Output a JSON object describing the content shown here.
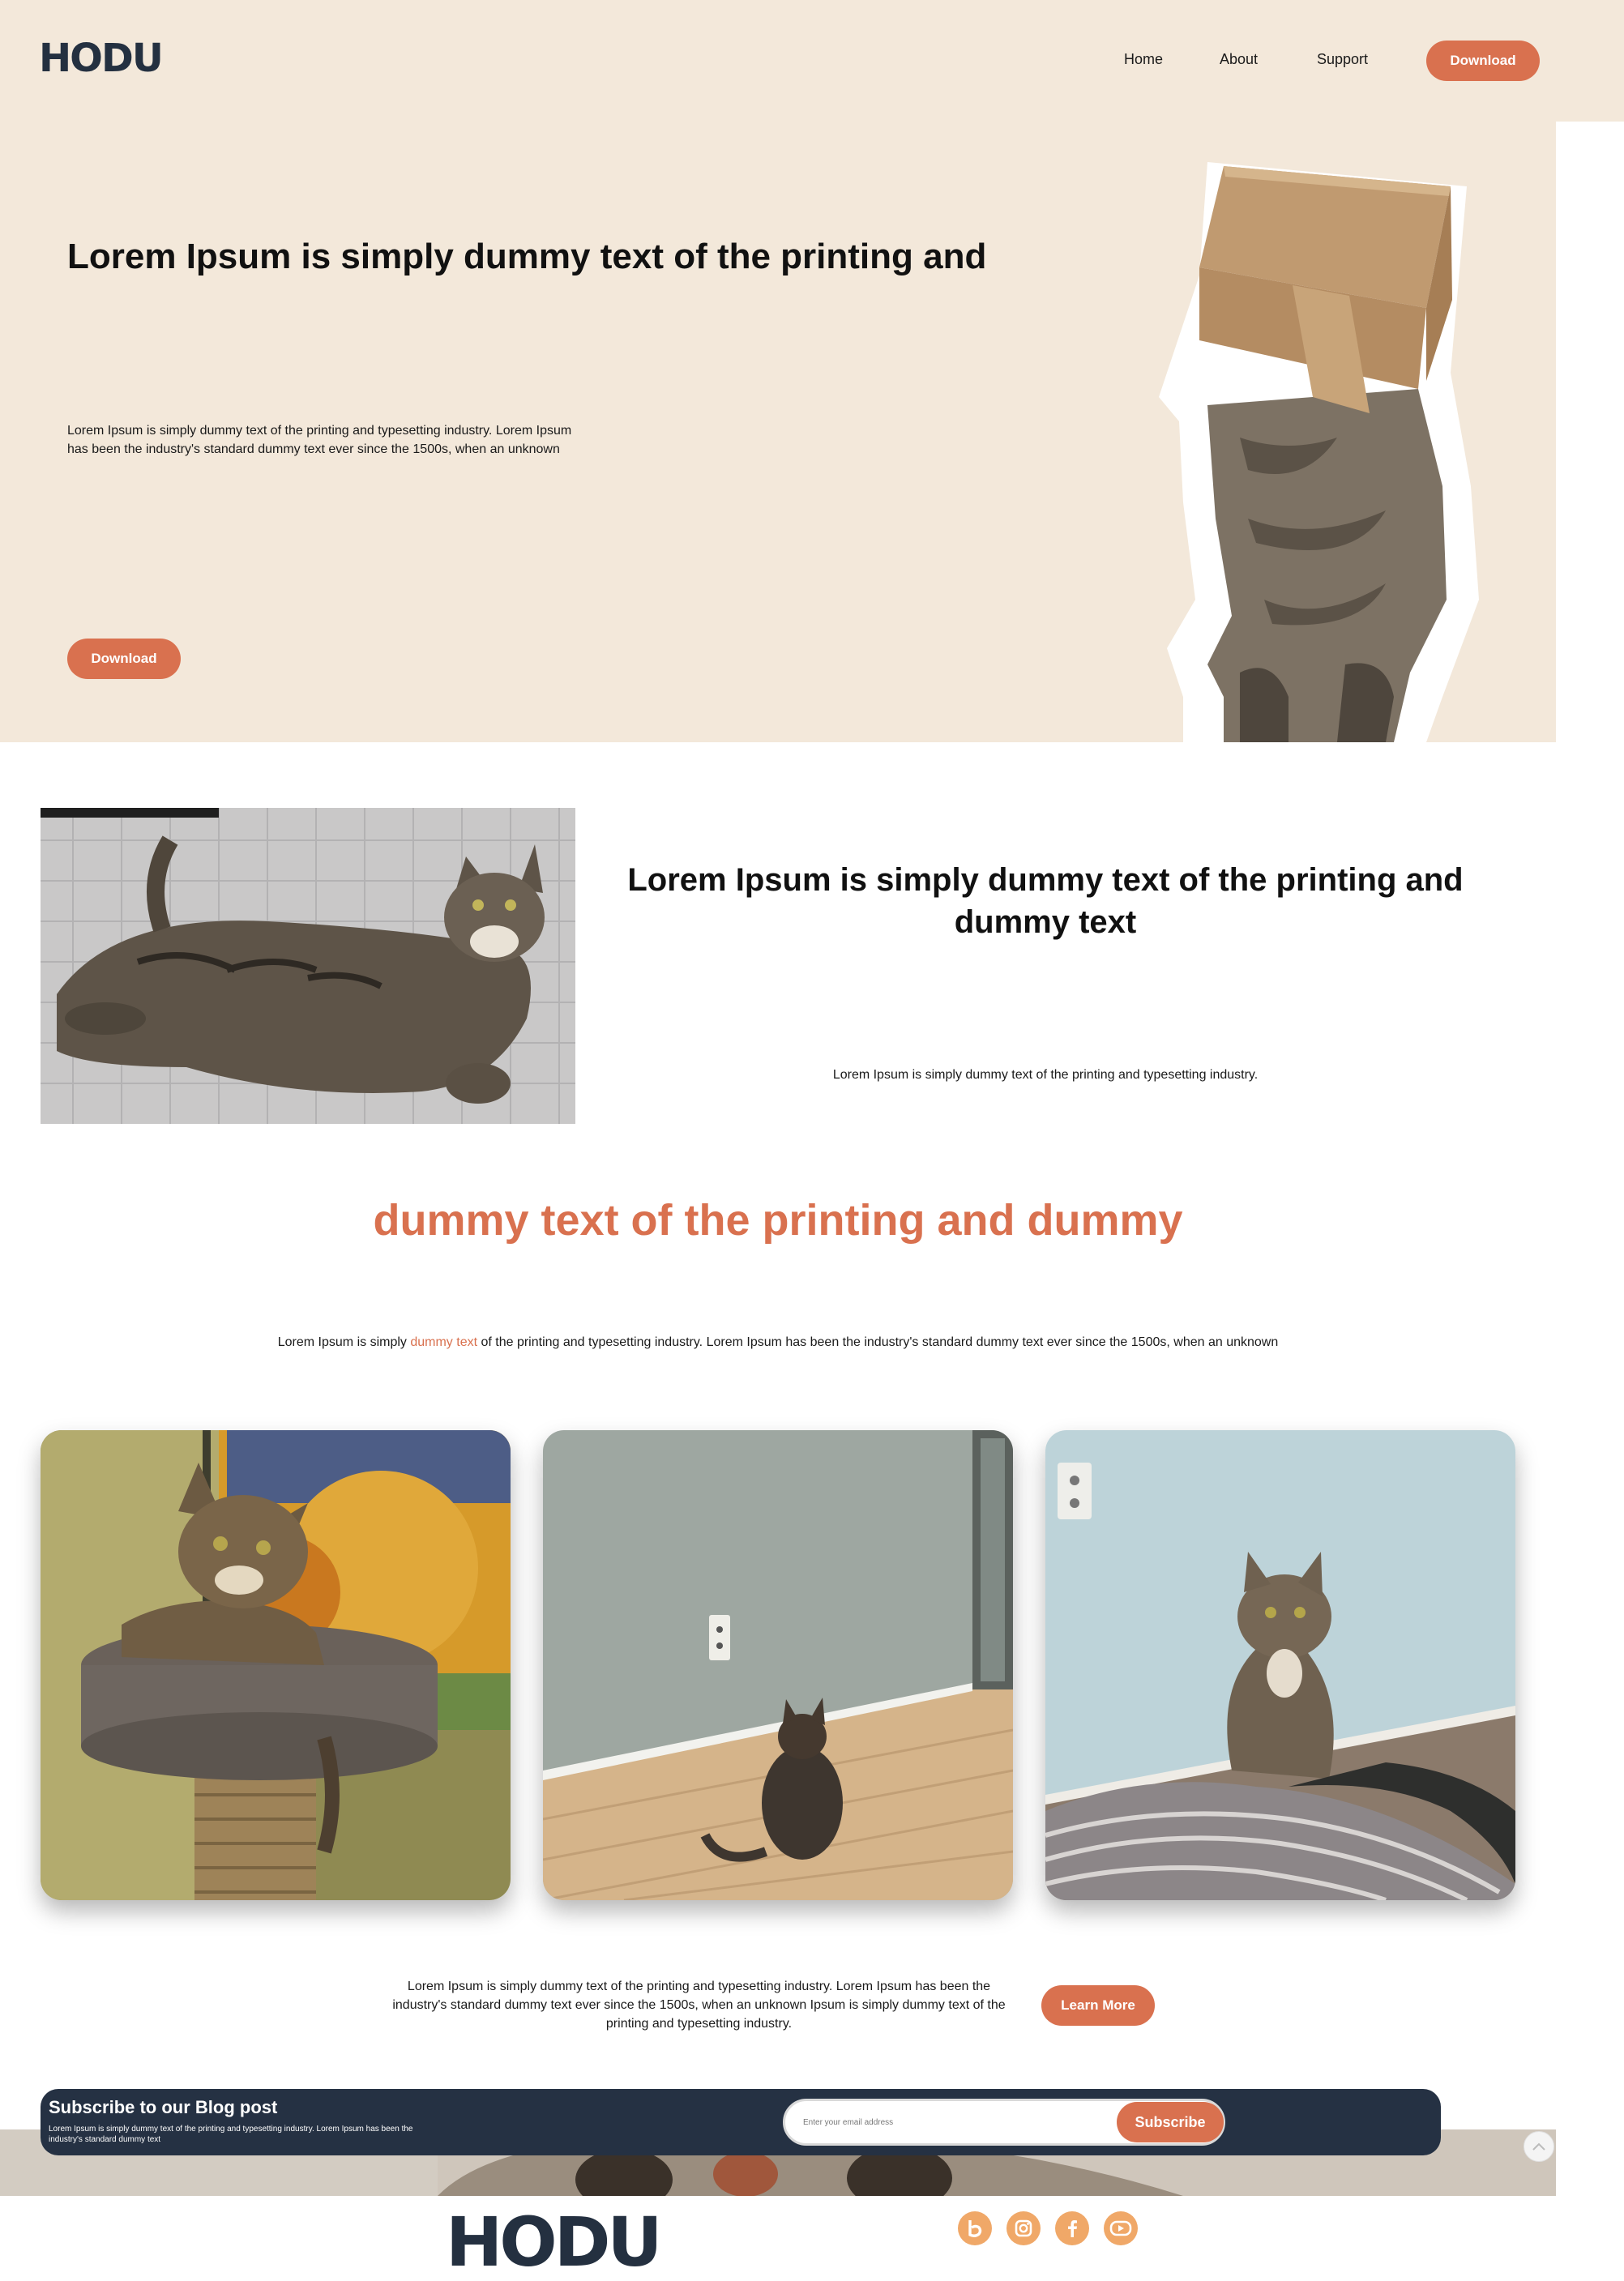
{
  "brand": {
    "logo": "HODU"
  },
  "nav": {
    "items": [
      "Home",
      "About",
      "Support"
    ],
    "download": "Download"
  },
  "hero": {
    "title": "Lorem Ipsum is simply dummy text of the printing and",
    "body": "Lorem Ipsum is simply dummy text of the printing and typesetting industry. Lorem Ipsum has been the industry's standard dummy text ever since the 1500s, when an unknown",
    "cta": "Download"
  },
  "feature": {
    "title": "Lorem Ipsum is simply dummy text of the printing and dummy text",
    "body": "Lorem Ipsum is simply dummy text of the printing and typesetting industry."
  },
  "gallery": {
    "title": "dummy text of the printing and dummy",
    "body_before": "Lorem Ipsum is simply ",
    "body_accent": "dummy text",
    "body_after": " of the printing and typesetting industry. Lorem Ipsum has been the industry's standard dummy text ever since the 1500s, when an unknown"
  },
  "learn_more": {
    "text": "Lorem Ipsum is simply dummy text of the printing and typesetting industry. Lorem Ipsum has been the industry's standard dummy text ever since the 1500s, when an unknown Ipsum is simply dummy text of the printing and typesetting industry.",
    "button": "Learn More"
  },
  "subscribe": {
    "title": "Subscribe to our Blog post",
    "body": "Lorem Ipsum is simply dummy text of the printing and typesetting industry. Lorem Ipsum has been the industry's standard dummy text",
    "placeholder": "Enter your email address",
    "button": "Subscribe"
  },
  "footer": {
    "logo": "HODU",
    "social": [
      "blog-icon",
      "instagram-icon",
      "facebook-icon",
      "youtube-icon"
    ]
  },
  "colors": {
    "accent": "#d9714f",
    "cream": "#f3e8da",
    "navy": "#253143",
    "social": "#f0a868"
  }
}
